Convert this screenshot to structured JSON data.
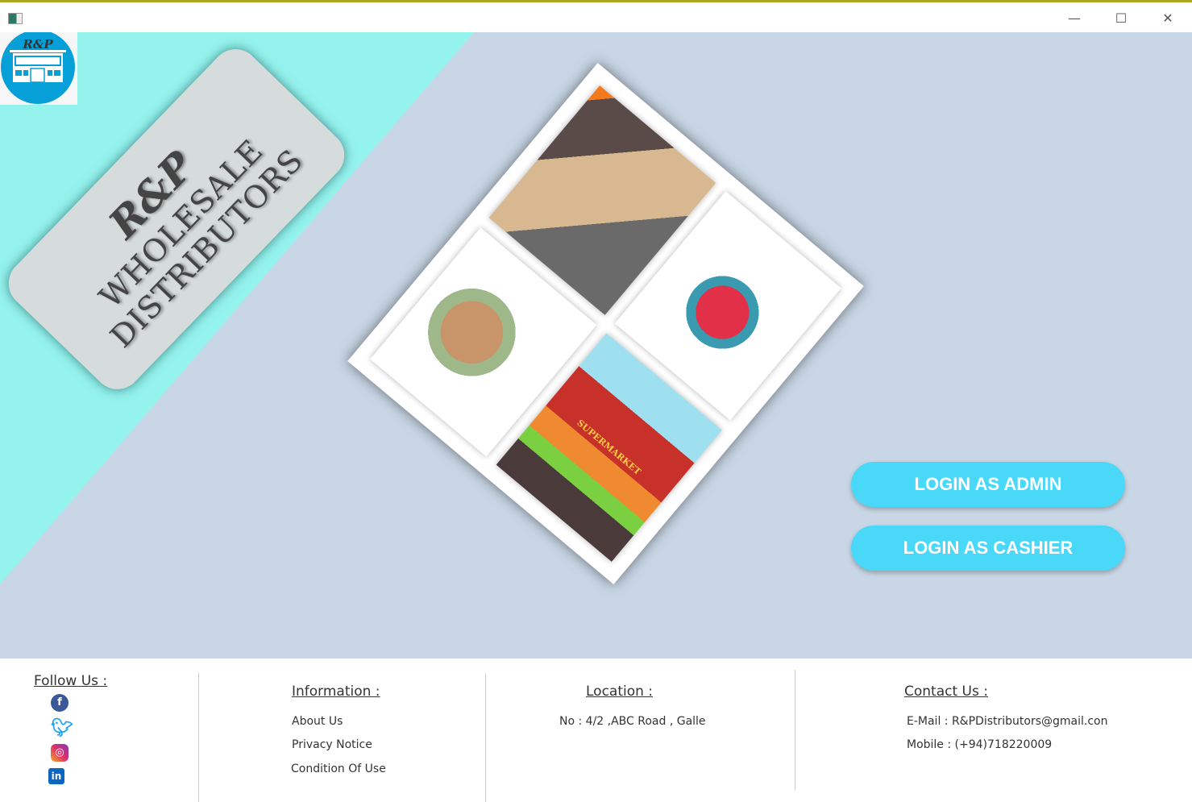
{
  "window": {
    "controls": {
      "minimize": "—",
      "maximize": "☐",
      "close": "✕"
    }
  },
  "logo": {
    "text": "R&P"
  },
  "brand": {
    "line1": "R&P",
    "line2": "WHOLESALE",
    "line3": "DISTRIBUTORS"
  },
  "panels": [
    "warehouse",
    "delivery-man",
    "supermarket-checkout",
    "supermarket"
  ],
  "panel_sign": "SUPERMARKET",
  "buttons": {
    "admin": "LOGIN AS ADMIN",
    "cashier": "LOGIN AS CASHIER"
  },
  "colors": {
    "accent": "#4ad8f8",
    "cyan": "#95f3ee",
    "background": "#c8d6e5"
  },
  "footer": {
    "follow": {
      "title": "Follow Us :",
      "icons": [
        "facebook-icon",
        "twitter-icon",
        "instagram-icon",
        "linkedin-icon"
      ]
    },
    "information": {
      "title": "Information :",
      "items": [
        "About Us",
        "Privacy Notice",
        "Condition Of Use"
      ]
    },
    "location": {
      "title": "Location :",
      "address": "No : 4/2 ,ABC Road , Galle"
    },
    "contact": {
      "title": "Contact Us :",
      "email": "E-Mail : R&PDistributors@gmail.con",
      "mobile": "Mobile : (+94)718220009"
    }
  }
}
